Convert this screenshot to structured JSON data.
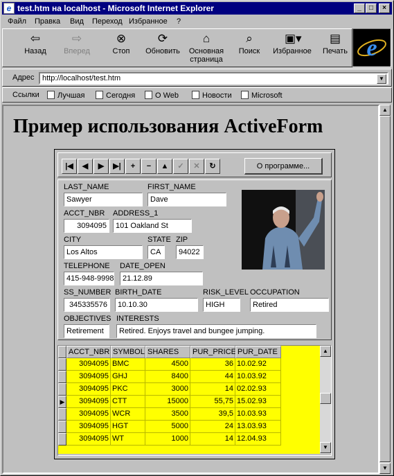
{
  "window": {
    "title": "test.htm на localhost - Microsoft Internet Explorer",
    "minimize": "_",
    "maximize": "□",
    "close": "×"
  },
  "menu": [
    "Файл",
    "Правка",
    "Вид",
    "Переход",
    "Избранное",
    "?"
  ],
  "toolbar": {
    "back": "Назад",
    "forward": "Вперед",
    "stop": "Стоп",
    "refresh": "Обновить",
    "home_line1": "Основная",
    "home_line2": "страница",
    "search": "Поиск",
    "favorites": "Избранное",
    "print": "Печать"
  },
  "address": {
    "label": "Адрес",
    "value": "http://localhost/test.htm"
  },
  "links": {
    "label": "Ссылки",
    "items": [
      "Лучшая",
      "Сегодня",
      "О Web",
      "Новости",
      "Microsoft"
    ]
  },
  "page": {
    "heading": "Пример использования ActiveForm"
  },
  "form": {
    "about_button": "О программе...",
    "labels": {
      "last_name": "LAST_NAME",
      "first_name": "FIRST_NAME",
      "acct_nbr": "ACCT_NBR",
      "address_1": "ADDRESS_1",
      "city": "CITY",
      "state": "STATE",
      "zip": "ZIP",
      "telephone": "TELEPHONE",
      "date_open": "DATE_OPEN",
      "ss_number": "SS_NUMBER",
      "birth_date": "BIRTH_DATE",
      "risk_level": "RISK_LEVEL",
      "occupation": "OCCUPATION",
      "objectives": "OBJECTIVES",
      "interests": "INTERESTS"
    },
    "values": {
      "last_name": "Sawyer",
      "first_name": "Dave",
      "acct_nbr": "3094095",
      "address_1": "101 Oakland St",
      "city": "Los Altos",
      "state": "CA",
      "zip": "94022",
      "telephone": "415-948-9998",
      "date_open": "21.12.89",
      "ss_number": "345335576",
      "birth_date": "10.10.30",
      "risk_level": "HIGH",
      "occupation": "Retired",
      "objectives": "Retirement",
      "interests": "Retired. Enjoys travel and bungee jumping."
    }
  },
  "grid": {
    "columns": [
      "ACCT_NBR",
      "SYMBOL",
      "SHARES",
      "PUR_PRICE",
      "PUR_DATE"
    ],
    "rows": [
      [
        "3094095",
        "BMC",
        "4500",
        "36",
        "10.02.92"
      ],
      [
        "3094095",
        "GHJ",
        "8400",
        "44",
        "10.03.92"
      ],
      [
        "3094095",
        "PKC",
        "3000",
        "14",
        "02.02.93"
      ],
      [
        "3094095",
        "CTT",
        "15000",
        "55,75",
        "15.02.93"
      ],
      [
        "3094095",
        "WCR",
        "3500",
        "39,5",
        "10.03.93"
      ],
      [
        "3094095",
        "HGT",
        "5000",
        "24",
        "13.03.93"
      ],
      [
        "3094095",
        "WT",
        "1000",
        "14",
        "12.04.93"
      ]
    ],
    "current_row": 3
  }
}
